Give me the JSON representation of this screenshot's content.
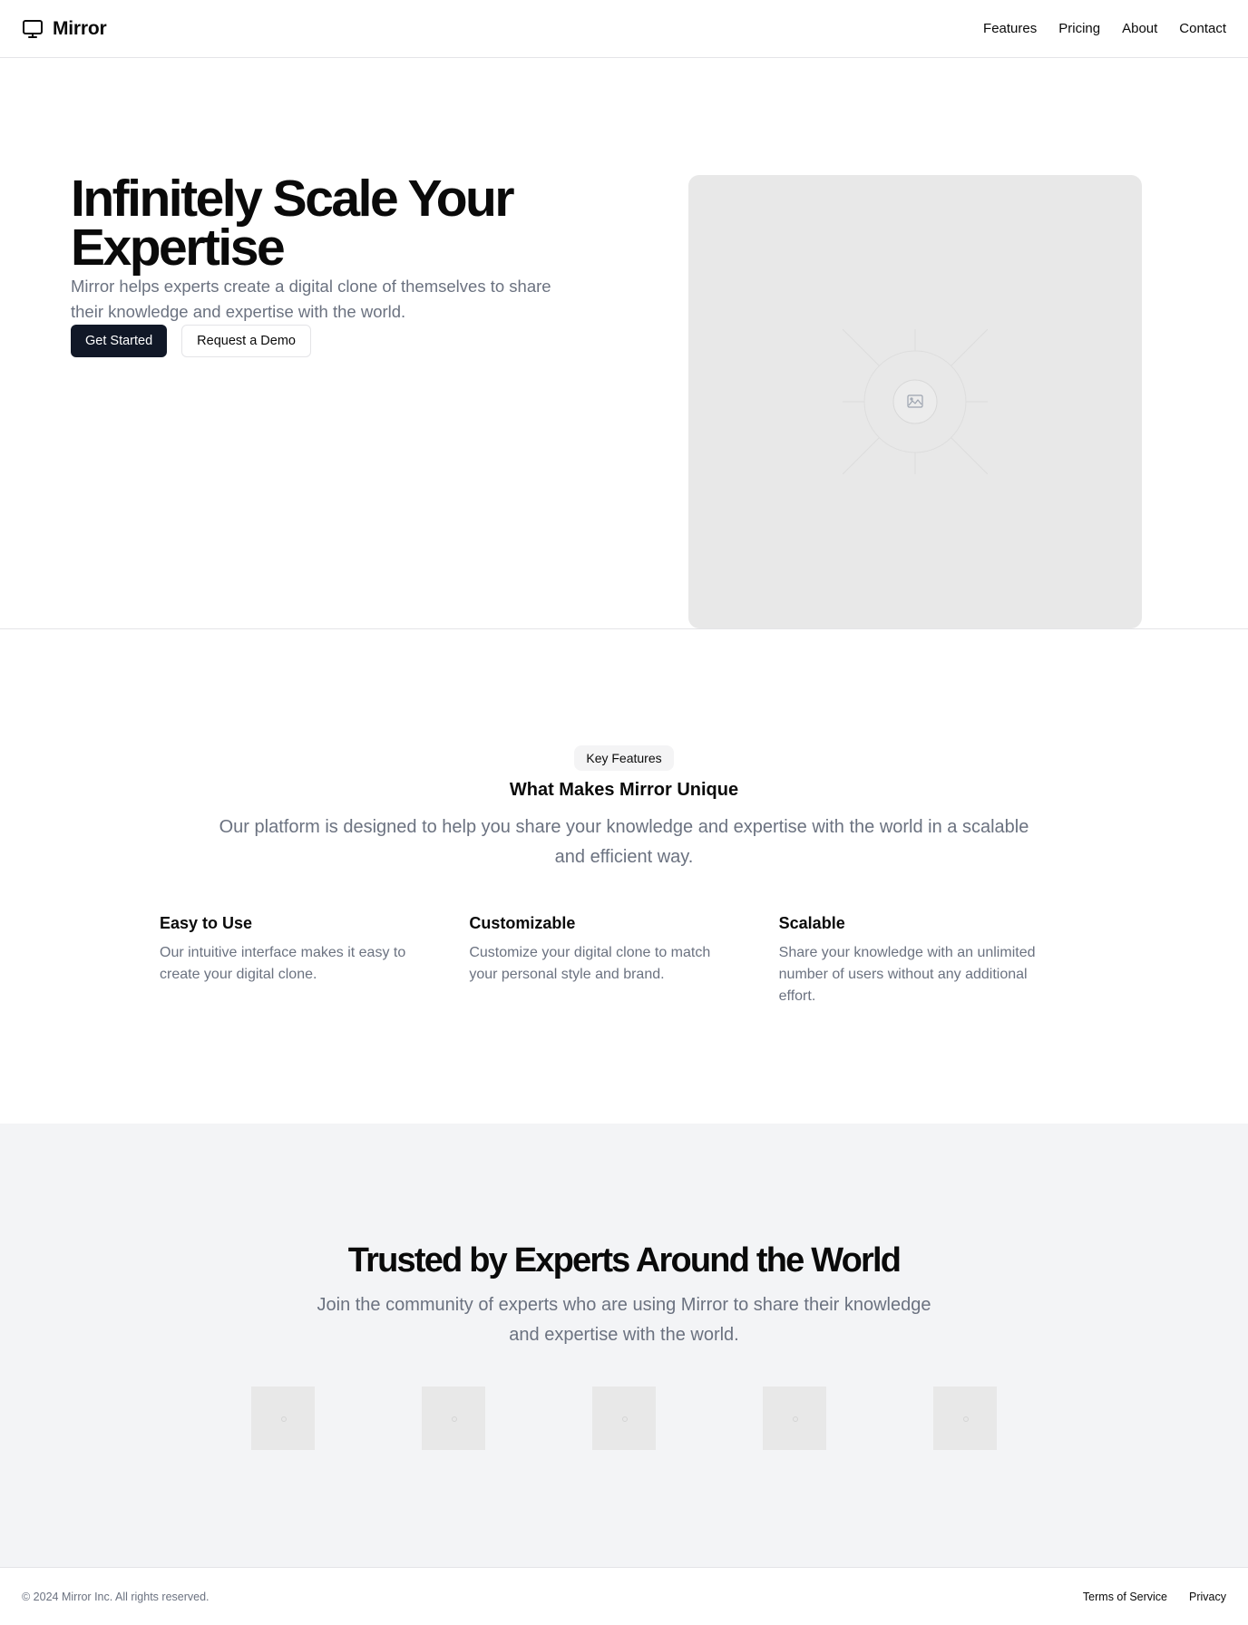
{
  "header": {
    "brand_name": "Mirror",
    "brand_icon": "monitor-icon",
    "nav": [
      {
        "label": "Features"
      },
      {
        "label": "Pricing"
      },
      {
        "label": "About"
      },
      {
        "label": "Contact"
      }
    ]
  },
  "hero": {
    "title": "Infinitely Scale Your Expertise",
    "subtitle": "Mirror helps experts create a digital clone of themselves to share their knowledge and expertise with the world.",
    "primary_button": "Get Started",
    "secondary_button": "Request a Demo",
    "image_icon": "image-placeholder-icon"
  },
  "features": {
    "badge": "Key Features",
    "title": "What Makes Mirror Unique",
    "subtitle": "Our platform is designed to help you share your knowledge and expertise with the world in a scalable and efficient way.",
    "items": [
      {
        "title": "Easy to Use",
        "description": "Our intuitive interface makes it easy to create your digital clone."
      },
      {
        "title": "Customizable",
        "description": "Customize your digital clone to match your personal style and brand."
      },
      {
        "title": "Scalable",
        "description": "Share your knowledge with an unlimited number of users without any additional effort."
      }
    ]
  },
  "trusted": {
    "title": "Trusted by Experts Around the World",
    "subtitle": "Join the community of experts who are using Mirror to share their knowledge and expertise with the world.",
    "logo_count": 5
  },
  "footer": {
    "copyright": "© 2024 Mirror Inc. All rights reserved.",
    "links": [
      {
        "label": "Terms of Service"
      },
      {
        "label": "Privacy"
      }
    ]
  },
  "colors": {
    "primary_button_bg": "#111827",
    "muted_text": "#6b7280",
    "placeholder_bg": "#e8e8e8",
    "section_bg": "#f3f4f6"
  }
}
